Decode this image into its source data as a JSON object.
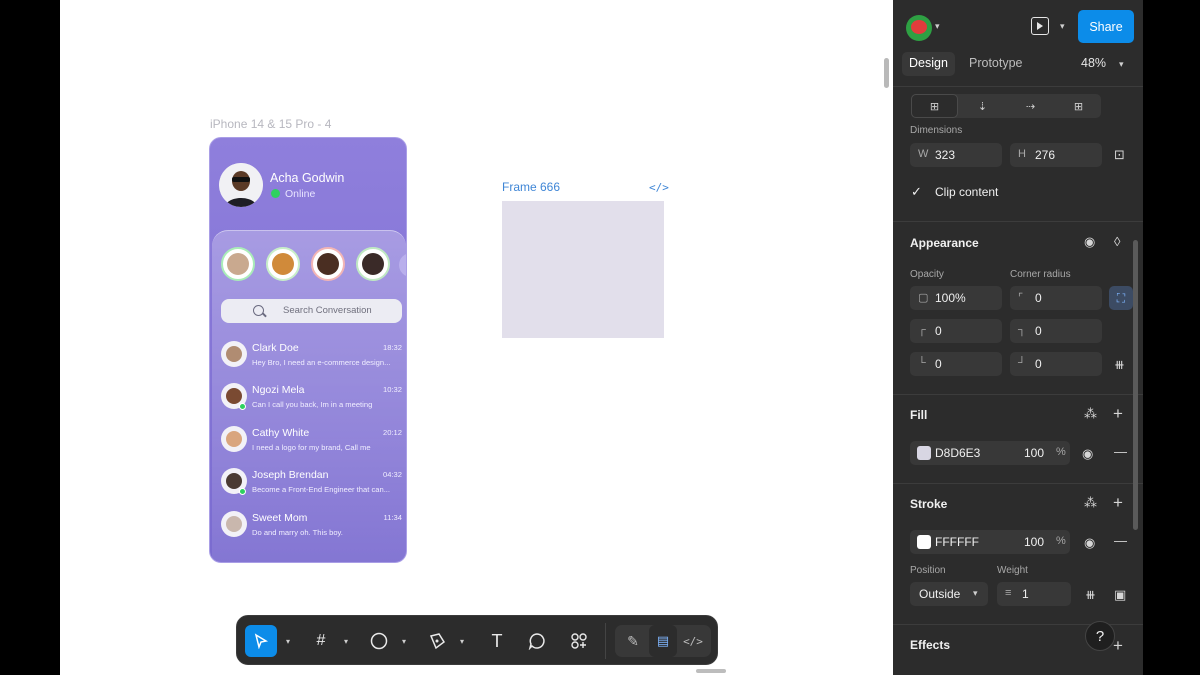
{
  "canvas": {
    "phone_frame_label": "iPhone 14 & 15 Pro - 4",
    "frame_label": "Frame 666",
    "code_glyph": "</>",
    "phone": {
      "user_name": "Acha Godwin",
      "status": "Online",
      "search_placeholder": "Search Conversation",
      "chats": [
        {
          "name": "Clark Doe",
          "message": "Hey Bro, I need an e-commerce design...",
          "time": "18:32"
        },
        {
          "name": "Ngozi Mela",
          "message": "Can I call you back, Im in a meeting",
          "time": "10:32"
        },
        {
          "name": "Cathy White",
          "message": "I need a logo for my brand, Call me",
          "time": "20:12"
        },
        {
          "name": "Joseph Brendan",
          "message": "Become a Front-End Engineer that can...",
          "time": "04:32"
        },
        {
          "name": "Sweet Mom",
          "message": "Do and marry oh. This boy.",
          "time": "11:34"
        }
      ]
    }
  },
  "toolbar": {
    "tools": [
      "move-tool",
      "frame-tool",
      "shape-tool",
      "pen-tool",
      "text-tool",
      "comment-tool",
      "actions-tool"
    ],
    "text_glyph": "T"
  },
  "panel": {
    "share_label": "Share",
    "tabs": {
      "design": "Design",
      "prototype": "Prototype"
    },
    "zoom": "48%",
    "dimensions": {
      "label": "Dimensions",
      "w_prefix": "W",
      "w": "323",
      "h_prefix": "H",
      "h": "276",
      "clip_content": "Clip content"
    },
    "appearance": {
      "heading": "Appearance",
      "opacity_label": "Opacity",
      "opacity": "100%",
      "corner_radius_label": "Corner radius",
      "corner_radius": "0",
      "top_left": "0",
      "top_right": "0",
      "bottom_left": "0",
      "bottom_right": "0"
    },
    "fill": {
      "heading": "Fill",
      "hex": "D8D6E3",
      "opacity": "100",
      "percent": "%",
      "color": "#D8D6E3"
    },
    "stroke": {
      "heading": "Stroke",
      "hex": "FFFFFF",
      "opacity": "100",
      "percent": "%",
      "color": "#FFFFFF",
      "position_label": "Position",
      "position": "Outside",
      "weight_label": "Weight",
      "weight": "1"
    },
    "effects": {
      "heading": "Effects"
    },
    "help": "?"
  },
  "colors": {
    "accent": "#0c8ce9",
    "phone_bg": "#7a6bd0",
    "online": "#2ed15f"
  }
}
